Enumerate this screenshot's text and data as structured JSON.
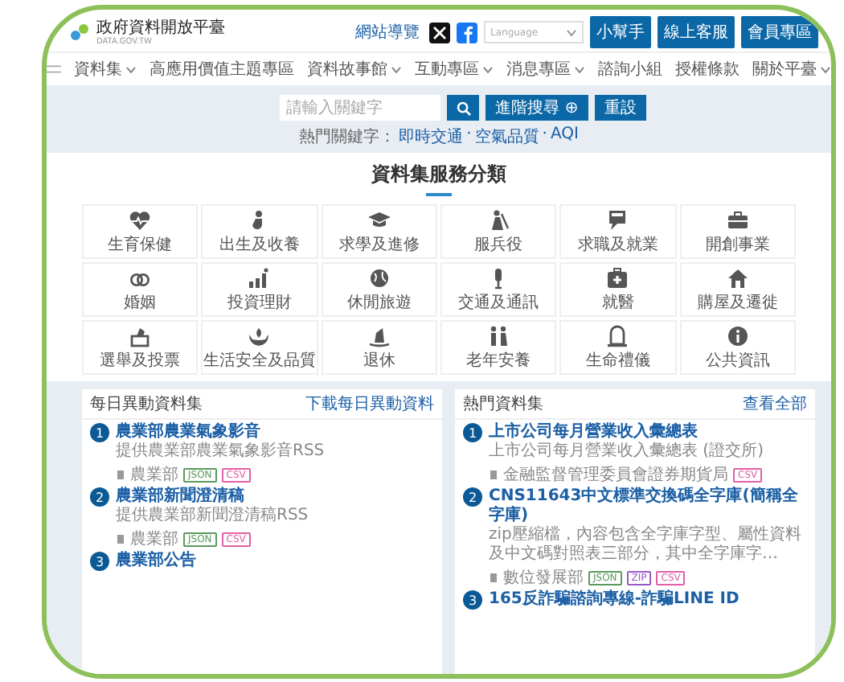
{
  "header": {
    "logo_title": "政府資料開放平臺",
    "logo_subtitle": "DATA.GOV.TW",
    "sitemap_link": "網站導覽",
    "language_select": {
      "placeholder": "Language"
    },
    "buttons": [
      "小幫手",
      "線上客服",
      "會員專區"
    ]
  },
  "nav": {
    "items": [
      {
        "label": "資料集",
        "dropdown": true
      },
      {
        "label": "高應用價值主題專區",
        "dropdown": false
      },
      {
        "label": "資料故事館",
        "dropdown": true
      },
      {
        "label": "互動專區",
        "dropdown": true
      },
      {
        "label": "消息專區",
        "dropdown": true
      },
      {
        "label": "諮詢小組",
        "dropdown": false
      },
      {
        "label": "授權條款",
        "dropdown": false
      },
      {
        "label": "關於平臺",
        "dropdown": true
      }
    ]
  },
  "search": {
    "placeholder": "請輸入關鍵字",
    "advanced_button": "進階搜尋 ⊕",
    "reset_button": "重設",
    "hot_keywords_label": "熱門關鍵字：",
    "hot_keywords": [
      "即時交通",
      "空氣品質",
      "AQI"
    ],
    "keyword_separator": "·"
  },
  "categories": {
    "title": "資料集服務分類",
    "items": [
      "生育保健",
      "出生及收養",
      "求學及進修",
      "服兵役",
      "求職及就業",
      "開創事業",
      "婚姻",
      "投資理財",
      "休閒旅遊",
      "交通及通訊",
      "就醫",
      "購屋及遷徙",
      "選舉及投票",
      "生活安全及品質",
      "退休",
      "老年安養",
      "生命禮儀",
      "公共資訊"
    ]
  },
  "panels": [
    {
      "title": "每日異動資料集",
      "link": "下載每日異動資料",
      "items": [
        {
          "number": "1",
          "title": "農業部農業氣象影音",
          "description": "提供農業部農業氣象影音RSS",
          "agency": "農業部",
          "tags": [
            {
              "label": "JSON",
              "color": "#5b9a5b"
            },
            {
              "label": "CSV",
              "color": "#e060a8"
            }
          ]
        },
        {
          "number": "2",
          "title": "農業部新聞澄清稿",
          "description": "提供農業部新聞澄清稿RSS",
          "agency": "農業部",
          "tags": [
            {
              "label": "JSON",
              "color": "#5b9a5b"
            },
            {
              "label": "CSV",
              "color": "#e060a8"
            }
          ]
        },
        {
          "number": "3",
          "title": "農業部公告"
        }
      ]
    },
    {
      "title": "熱門資料集",
      "link": "查看全部",
      "items": [
        {
          "number": "1",
          "title": "上市公司每月營業收入彙總表",
          "description": "上市公司每月營業收入彙總表 (證交所)",
          "agency": "金融監督管理委員會證券期貨局",
          "tags": [
            {
              "label": "CSV",
              "color": "#e060a8"
            }
          ]
        },
        {
          "number": "2",
          "title": "CNS11643中文標準交換碼全字庫(簡稱全字庫)",
          "description": "zip壓縮檔，內容包含全字庫字型、屬性資料及中文碼對照表三部分，其中全字庫字…",
          "agency": "數位發展部",
          "tags": [
            {
              "label": "JSON",
              "color": "#5b9a5b"
            },
            {
              "label": "ZIP",
              "color": "#9b59c8"
            },
            {
              "label": "CSV",
              "color": "#e060a8"
            }
          ]
        },
        {
          "number": "3",
          "title": "165反詐騙諮詢專線-詐騙LINE ID"
        }
      ]
    }
  ]
}
